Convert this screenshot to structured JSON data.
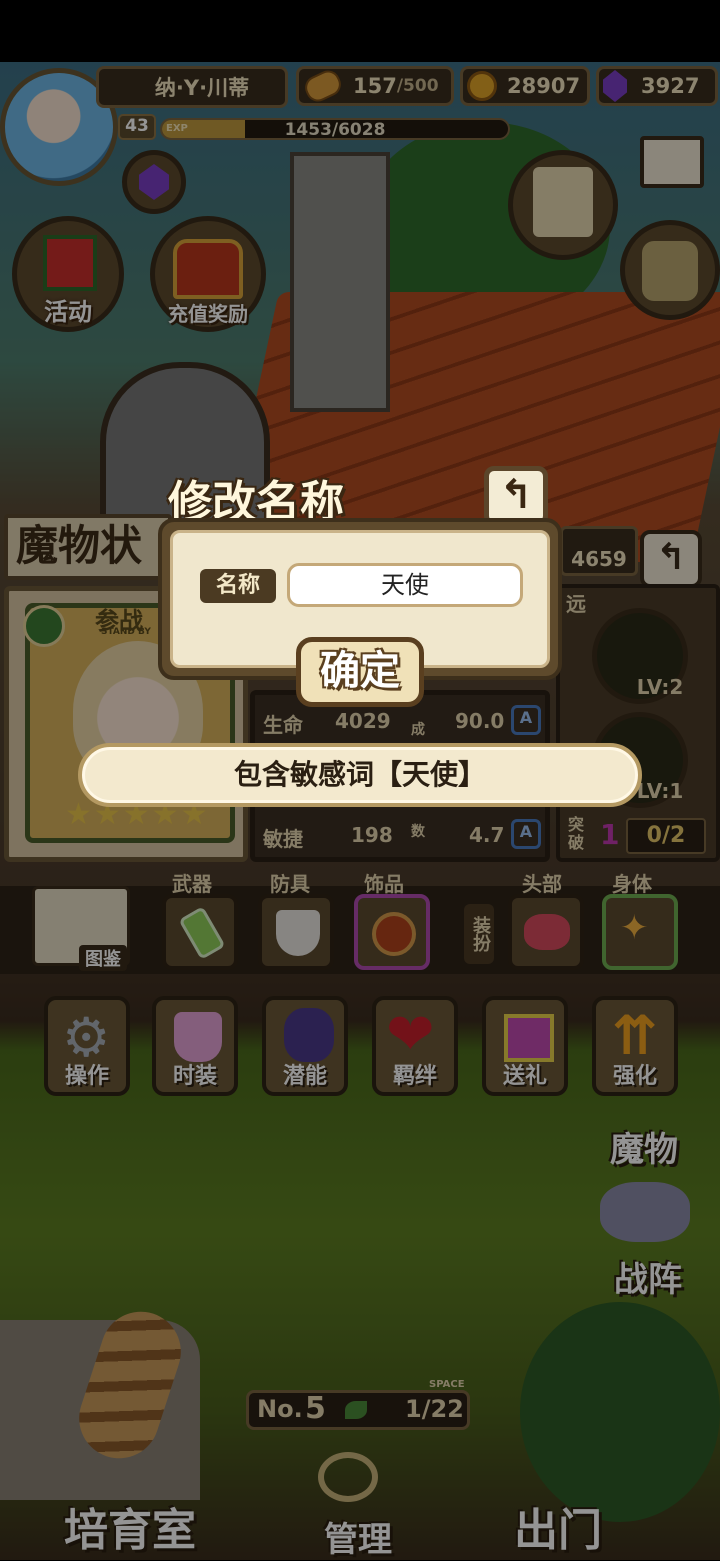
{
  "header": {
    "player_name": "纳·Y·川蒂",
    "bread": "157",
    "bread_max": "/500",
    "gold": "28907",
    "gems": "3927",
    "level": "43",
    "exp_label": "EXP",
    "exp": "1453/6028",
    "exp_fraction": 0.24
  },
  "left_menu": {
    "activity": "活动",
    "recharge": "充值奖励",
    "monster_title": "魔物状"
  },
  "char_panel": {
    "badge": "参战",
    "badge_sub": "STAND BY",
    "power_value": "4659",
    "distance": "远",
    "skills": [
      {
        "level": "LV:2"
      },
      {
        "level": "LV:1"
      }
    ],
    "stats": [
      {
        "label": "生命",
        "value": "4029"
      },
      {
        "label": "敏捷",
        "value": "198"
      }
    ],
    "side_stats": [
      {
        "label": "成",
        "value": "90.0"
      },
      {
        "label": "数",
        "value": "4.7"
      }
    ],
    "breakthrough_label": "突破",
    "breakthrough_value": "1",
    "breakthrough_progress": "0/2"
  },
  "dialog": {
    "title": "修改名称",
    "field_label": "名称",
    "field_value": "天使",
    "confirm": "确定"
  },
  "toast": "包含敏感词【天使】",
  "equipment": {
    "guide": "图鉴",
    "slots": [
      "武器",
      "防具",
      "饰品",
      "头部",
      "身体"
    ],
    "dress_up": "装扮"
  },
  "actions": [
    "操作",
    "时装",
    "潜能",
    "羁绊",
    "送礼",
    "强化"
  ],
  "side_buttons": [
    "魔物",
    "战阵"
  ],
  "bottom": {
    "nursery": "培育室",
    "manage": "管理",
    "go_out": "出门",
    "no_label": "No.",
    "no_value": "5",
    "space_label": "SPACE",
    "space": "1/22"
  },
  "colors": {
    "accent_gold": "#bf9a3e",
    "gem_purple": "#7b3fc4",
    "wood_dark": "#3a2e1e"
  }
}
